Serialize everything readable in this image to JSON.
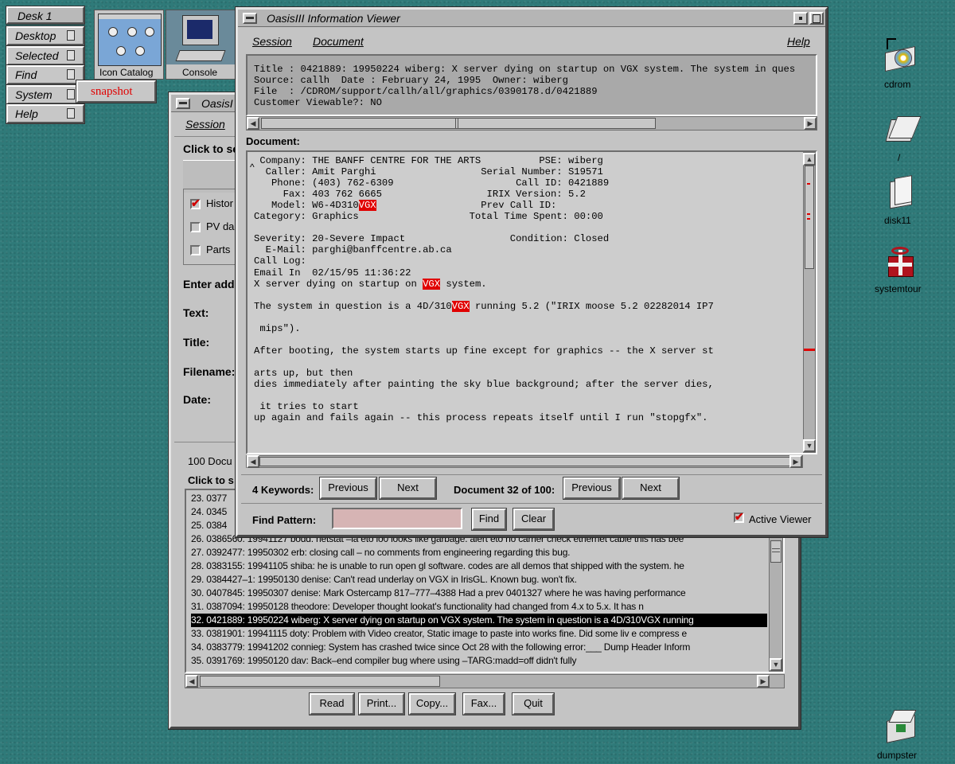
{
  "toolchest": {
    "title": "Desk 1",
    "items": [
      "Desktop",
      "Selected",
      "Find",
      "System",
      "Help"
    ],
    "popup": "snapshot"
  },
  "desktop": {
    "top_icons": [
      "Icon Catalog",
      "Console"
    ],
    "right_icons": [
      "cdrom",
      "/",
      "disk11",
      "systemtour",
      "dumpster"
    ]
  },
  "back_window": {
    "title": "OasisI",
    "menu": [
      "Session"
    ],
    "click_to_label": "Click to se",
    "checkboxes": [
      {
        "label": "Histor",
        "checked": true
      },
      {
        "label": "PV da",
        "checked": false
      },
      {
        "label": "Parts",
        "checked": false
      }
    ],
    "enter_label": "Enter addi",
    "fields": [
      "Text:",
      "Title:",
      "Filename:",
      "Date:"
    ],
    "doc_count": "100 Docu",
    "click_to_2": "Click to s",
    "list": [
      "23. 0377",
      "24. 0345",
      "25. 0384",
      "26. 0386560: 19941127 bodd: netstat –ia eto lo0 looks like garbage. alert eto no carrier check ethernet cable this has bee",
      "27. 0392477: 19950302 erb: closing call – no comments from engineering regarding this bug.",
      "28. 0383155: 19941105 shiba: he is unable to run open gl software. codes are all demos that shipped with the system. he",
      "29. 0384427–1: 19950130 denise: Can't read underlay on VGX in IrisGL. Known bug. won't fix.",
      "30. 0407845: 19950307 denise: Mark Ostercamp 817–777–4388 Had a prev 0401327 where he was having performance",
      "31. 0387094: 19950128 theodore: Developer thought lookat's functionality had changed from 4.x to 5.x. It has n",
      "32. 0421889: 19950224 wiberg: X server dying on startup on VGX system. The system in question is a 4D/310VGX running",
      "33. 0381901: 19941115 doty: Problem with Video creator, Static image to paste into works fine. Did some liv e compress e",
      "34. 0383779: 19941202 connieg: System has crashed twice since Oct 28 with the following error:___ Dump Header Inform",
      "35. 0391769: 19950120 dav: Back–end compiler bug where using –TARG:madd=off didn't fully"
    ],
    "selected_index": 9,
    "buttons": [
      "Read",
      "Print...",
      "Copy...",
      "Fax...",
      "Quit"
    ]
  },
  "viewer": {
    "title": "OasisIII Information Viewer",
    "menu": [
      "Session",
      "Document"
    ],
    "help": "Help",
    "header_lines": [
      "Title : 0421889: 19950224 wiberg: X server dying on startup on VGX system. The system in ques",
      "Source: callh  Date : February 24, 1995  Owner: wiberg",
      "File  : /CDROM/support/callh/all/graphics/0390178.d/0421889",
      "Customer Viewable?: NO"
    ],
    "document_label": "Document:",
    "doc_lines": [
      {
        "t": " Company: THE BANFF CENTRE FOR THE ARTS          PSE: wiberg"
      },
      {
        "t": "  Caller: Amit Parghi                  Serial Number: S19571"
      },
      {
        "t": "   Phone: (403) 762-6309                     Call ID: 0421889"
      },
      {
        "t": "     Fax: 403 762 6665                  IRIX Version: 5.2"
      },
      {
        "pre": "   Model: W6-4D310",
        "hl": "VGX",
        "post": "                  Prev Call ID:"
      },
      {
        "t": "Category: Graphics                   Total Time Spent: 00:00"
      },
      {
        "t": ""
      },
      {
        "t": "Severity: 20-Severe Impact                  Condition: Closed"
      },
      {
        "t": "  E-Mail: parghi@banffcentre.ab.ca"
      },
      {
        "t": "Call Log:"
      },
      {
        "t": "Email In  02/15/95 11:36:22"
      },
      {
        "pre": "X server dying on startup on ",
        "hl": "VGX",
        "post": " system."
      },
      {
        "t": ""
      },
      {
        "pre": "The system in question is a 4D/310",
        "hl": "VGX",
        "post": " running 5.2 (\"IRIX moose 5.2 02282014 IP7"
      },
      {
        "t": ""
      },
      {
        "t": " mips\")."
      },
      {
        "t": ""
      },
      {
        "t": "After booting, the system starts up fine except for graphics -- the X server st"
      },
      {
        "t": ""
      },
      {
        "t": "arts up, but then"
      },
      {
        "t": "dies immediately after painting the sky blue background; after the server dies,"
      },
      {
        "t": ""
      },
      {
        "t": " it tries to start"
      },
      {
        "t": "up again and fails again -- this process repeats itself until I run \"stopgfx\"."
      }
    ],
    "keywords_label": "4 Keywords:",
    "previous": "Previous",
    "next": "Next",
    "doc_of_label": "Document 32 of 100:",
    "find_label": "Find Pattern:",
    "find_value": "",
    "find_btn": "Find",
    "clear_btn": "Clear",
    "active_viewer": "Active Viewer"
  },
  "colors": {
    "desktop": "#2f7a79",
    "highlight": "#e00000",
    "find_field": "#d6b4b4"
  }
}
